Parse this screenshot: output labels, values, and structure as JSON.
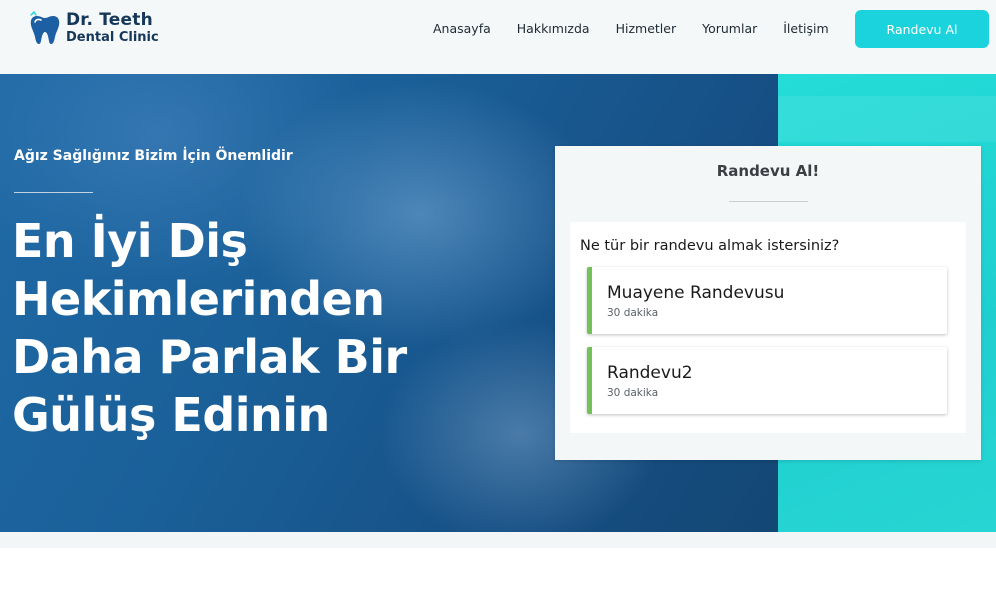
{
  "brand": {
    "name_line1": "Dr. Teeth",
    "name_line2": "Dental Clinic",
    "logo_icon": "tooth-icon"
  },
  "nav": {
    "items": [
      "Anasayfa",
      "Hakkımızda",
      "Hizmetler",
      "Yorumlar",
      "İletişim"
    ],
    "cta_label": "Randevu Al"
  },
  "hero": {
    "tagline": "Ağız Sağlığınız Bizim İçin Önemlidir",
    "heading_lines": [
      "En İyi Diş",
      "Hekimlerinden",
      "Daha Parlak Bir",
      "Gülüş Edinin"
    ]
  },
  "booking": {
    "title": "Randevu Al!",
    "question": "Ne tür bir randevu almak istersiniz?",
    "options": [
      {
        "name": "Muayene Randevusu",
        "duration": "30 dakika"
      },
      {
        "name": "Randevu2",
        "duration": "30 dakika"
      }
    ]
  },
  "colors": {
    "accent": "#1bd3dc",
    "brand_text": "#16375a",
    "option_border": "#72c159",
    "hero_blue": "#1a5f98"
  }
}
